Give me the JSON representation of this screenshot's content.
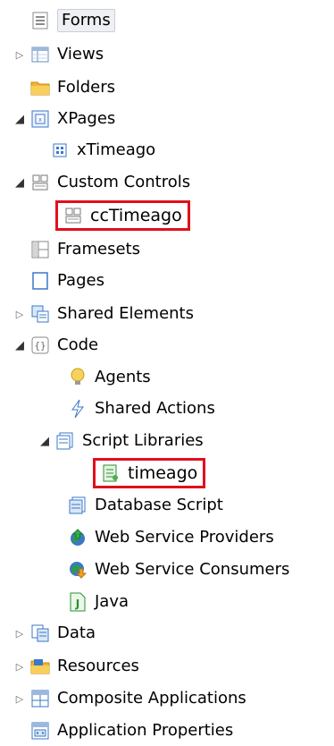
{
  "tree": {
    "items": [
      {
        "label": "Forms",
        "icon": "form-icon"
      },
      {
        "label": "Views",
        "icon": "view-icon"
      },
      {
        "label": "Folders",
        "icon": "folder-icon"
      },
      {
        "label": "XPages",
        "icon": "xpages-icon"
      },
      {
        "label": "xTimeago",
        "icon": "xpage-icon"
      },
      {
        "label": "Custom Controls",
        "icon": "custom-controls-icon"
      },
      {
        "label": "ccTimeago",
        "icon": "custom-control-icon"
      },
      {
        "label": "Framesets",
        "icon": "frameset-icon"
      },
      {
        "label": "Pages",
        "icon": "page-icon"
      },
      {
        "label": "Shared Elements",
        "icon": "shared-elements-icon"
      },
      {
        "label": "Code",
        "icon": "code-icon"
      },
      {
        "label": "Agents",
        "icon": "agent-icon"
      },
      {
        "label": "Shared Actions",
        "icon": "shared-actions-icon"
      },
      {
        "label": "Script Libraries",
        "icon": "script-libraries-icon"
      },
      {
        "label": "timeago",
        "icon": "script-library-icon"
      },
      {
        "label": "Database Script",
        "icon": "database-script-icon"
      },
      {
        "label": "Web Service Providers",
        "icon": "web-service-provider-icon"
      },
      {
        "label": "Web Service Consumers",
        "icon": "web-service-consumer-icon"
      },
      {
        "label": "Java",
        "icon": "java-icon"
      },
      {
        "label": "Data",
        "icon": "data-icon"
      },
      {
        "label": "Resources",
        "icon": "resources-icon"
      },
      {
        "label": "Composite Applications",
        "icon": "composite-applications-icon"
      },
      {
        "label": "Application Properties",
        "icon": "application-properties-icon"
      }
    ]
  },
  "colors": {
    "highlight": "#e0101c",
    "folder": "#f0b431",
    "blue": "#3a78c8"
  }
}
